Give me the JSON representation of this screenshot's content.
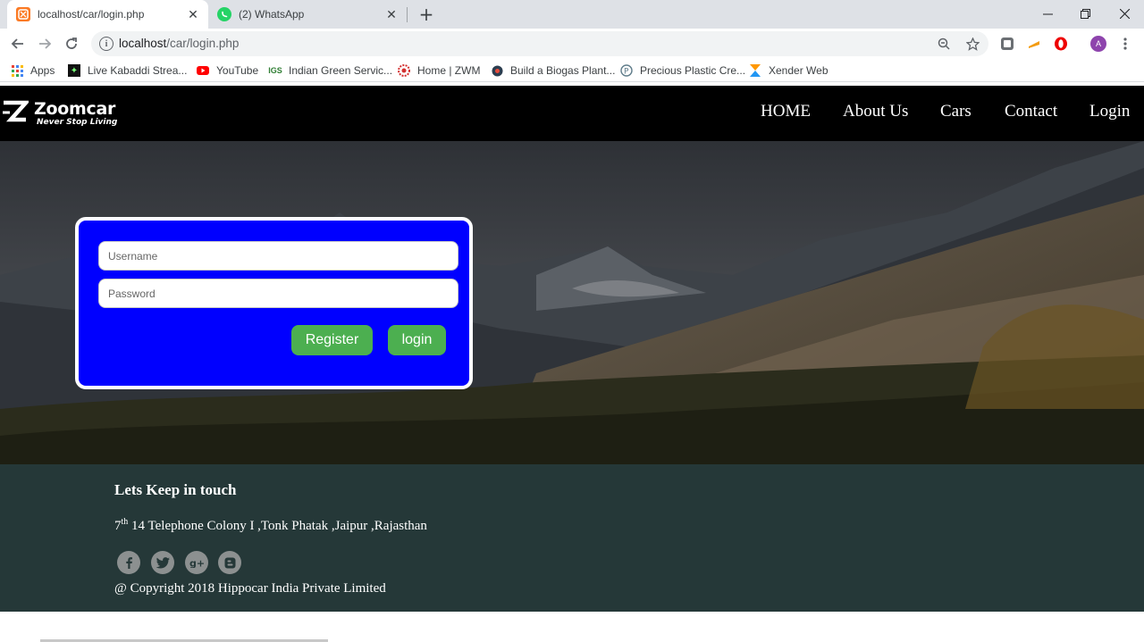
{
  "browser": {
    "tabs": [
      {
        "title": "localhost/car/login.php",
        "favicon": "xampp-icon",
        "active": true
      },
      {
        "title": "(2) WhatsApp",
        "favicon": "whatsapp-icon",
        "active": false
      }
    ],
    "url_host": "localhost",
    "url_path": "/car/login.php",
    "bookmarks": [
      {
        "label": "Apps",
        "icon": "apps-grid-icon"
      },
      {
        "label": "Live Kabaddi Strea...",
        "icon": "kabaddi-icon"
      },
      {
        "label": "YouTube",
        "icon": "youtube-icon"
      },
      {
        "label": "Indian Green Servic...",
        "icon": "igs-icon"
      },
      {
        "label": "Home | ZWM",
        "icon": "zwm-icon"
      },
      {
        "label": "Build a Biogas Plant...",
        "icon": "biogas-icon"
      },
      {
        "label": "Precious Plastic Cre...",
        "icon": "precious-plastic-icon"
      },
      {
        "label": "Xender Web",
        "icon": "xender-icon"
      }
    ],
    "profile_initial": "A"
  },
  "site": {
    "brand": "Zoomcar",
    "tagline": "Never Stop Living",
    "nav": [
      "HOME",
      "About Us",
      "Cars",
      "Contact",
      "Login"
    ]
  },
  "login": {
    "username_placeholder": "Username",
    "password_placeholder": "Password",
    "register_label": "Register",
    "login_label": "login"
  },
  "footer": {
    "heading": "Lets Keep in touch",
    "address_num": "7",
    "address_sup": "th",
    "address_rest": " 14 Telephone Colony I ,Tonk Phatak ,Jaipur ,Rajasthan",
    "social": [
      "facebook-icon",
      "twitter-icon",
      "google-plus-icon",
      "blogger-icon"
    ],
    "copyright": "@ Copyright 2018 Hippocar India Private Limited"
  },
  "colors": {
    "login_box": "#0000ff",
    "button": "#4caf50",
    "footer": "#253838",
    "header": "#000000"
  }
}
